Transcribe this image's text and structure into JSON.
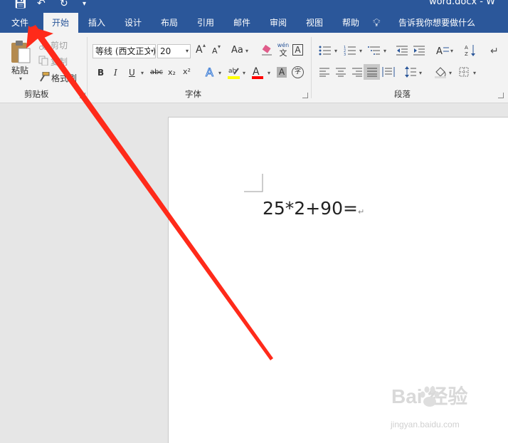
{
  "window": {
    "title": "word.docx - W"
  },
  "tabs": [
    {
      "label": "文件"
    },
    {
      "label": "开始"
    },
    {
      "label": "插入"
    },
    {
      "label": "设计"
    },
    {
      "label": "布局"
    },
    {
      "label": "引用"
    },
    {
      "label": "邮件"
    },
    {
      "label": "审阅"
    },
    {
      "label": "视图"
    },
    {
      "label": "帮助"
    }
  ],
  "active_tab": "开始",
  "tell_me": "告诉我你想要做什么",
  "ribbon": {
    "clipboard": {
      "label": "剪贴板",
      "paste": "粘贴",
      "cut": "剪切",
      "copy": "复制",
      "format_painter": "格式刷"
    },
    "font": {
      "label": "字体",
      "name": "等线 (西文正文)",
      "size": "20",
      "bold": "B",
      "italic": "I",
      "underline": "U",
      "strike": "abc",
      "sub": "x₂",
      "sup": "x²",
      "grow": "A",
      "shrink": "A",
      "case": "Aa",
      "pinyin_top": "wén",
      "pinyin_bottom": "文",
      "char_border": "A",
      "char_shading": "A",
      "enclose": "字"
    },
    "paragraph": {
      "label": "段落"
    }
  },
  "document": {
    "text": "25*2+90=",
    "para_mark": "↵"
  },
  "watermark": {
    "brand": "Bai  经验",
    "url": "jingyan.baidu.com"
  },
  "colors": {
    "ribbon_blue": "#2b579a",
    "highlight": "#ffff00",
    "font_color": "#ff0000",
    "arrow": "#ff2a1a"
  }
}
